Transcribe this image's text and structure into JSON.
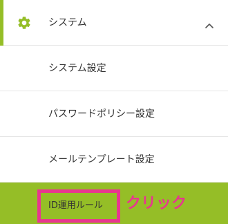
{
  "menu": {
    "parent": {
      "icon": "gear-icon",
      "label": "システム",
      "expand_icon": "chevron-up-icon"
    },
    "items": [
      {
        "label": "システム設定"
      },
      {
        "label": "パスワードポリシー設定"
      },
      {
        "label": "メールテンプレート設定"
      }
    ],
    "active_item": {
      "label": "ID運用ルール"
    }
  },
  "annotation": {
    "text": "クリック"
  },
  "colors": {
    "accent": "#95be27",
    "highlight": "#e8368f",
    "text": "#333333",
    "divider": "#e6e6e6"
  }
}
